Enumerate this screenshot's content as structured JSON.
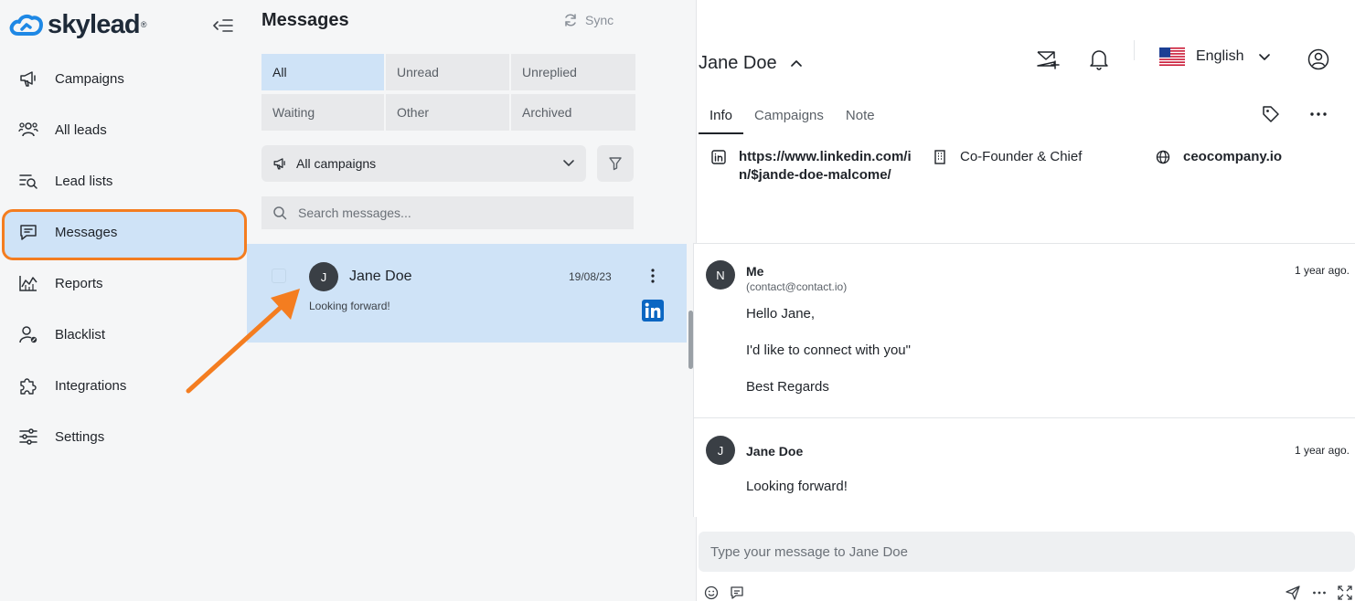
{
  "brand": {
    "name": "skylead",
    "registered": "®"
  },
  "sidebar": {
    "items": [
      {
        "label": "Campaigns",
        "icon": "megaphone-icon"
      },
      {
        "label": "All leads",
        "icon": "users-icon"
      },
      {
        "label": "Lead lists",
        "icon": "list-search-icon"
      },
      {
        "label": "Messages",
        "icon": "message-icon",
        "active": true
      },
      {
        "label": "Reports",
        "icon": "chart-icon"
      },
      {
        "label": "Blacklist",
        "icon": "user-block-icon"
      },
      {
        "label": "Integrations",
        "icon": "puzzle-icon"
      },
      {
        "label": "Settings",
        "icon": "sliders-icon"
      }
    ]
  },
  "list": {
    "title": "Messages",
    "sync_label": "Sync",
    "filters": [
      "All",
      "Unread",
      "Unreplied",
      "Waiting",
      "Other",
      "Archived"
    ],
    "active_filter": "All",
    "campaign_select": "All campaigns",
    "search_placeholder": "Search messages...",
    "conversations": [
      {
        "initial": "J",
        "name": "Jane Doe",
        "date": "19/08/23",
        "preview": "Looking forward!",
        "channel": "linkedin"
      }
    ]
  },
  "detail": {
    "name": "Jane Doe",
    "language": "English",
    "tabs": [
      "Info",
      "Campaigns",
      "Note"
    ],
    "active_tab": "Info",
    "info": {
      "linkedin_url": "https://www.linkedin.com/in/$jande-doe-malcome/",
      "title": "Co-Founder & Chief",
      "website": "ceocompany.io"
    },
    "messages": [
      {
        "initial": "N",
        "sender": "Me",
        "email": "(contact@contact.io)",
        "time": "1 year ago.",
        "lines": [
          "Hello Jane,",
          "I'd like to connect with you\"",
          "Best Regards"
        ]
      },
      {
        "initial": "J",
        "sender": "Jane Doe",
        "time": "1 year ago.",
        "lines": [
          "Looking forward!"
        ]
      }
    ],
    "composer_placeholder": "Type your message to Jane Doe"
  },
  "colors": {
    "accent_orange": "#f47d20",
    "active_bg": "#cfe3f7",
    "linkedin_blue": "#0a66c2",
    "brand_blue": "#1e88e5"
  }
}
